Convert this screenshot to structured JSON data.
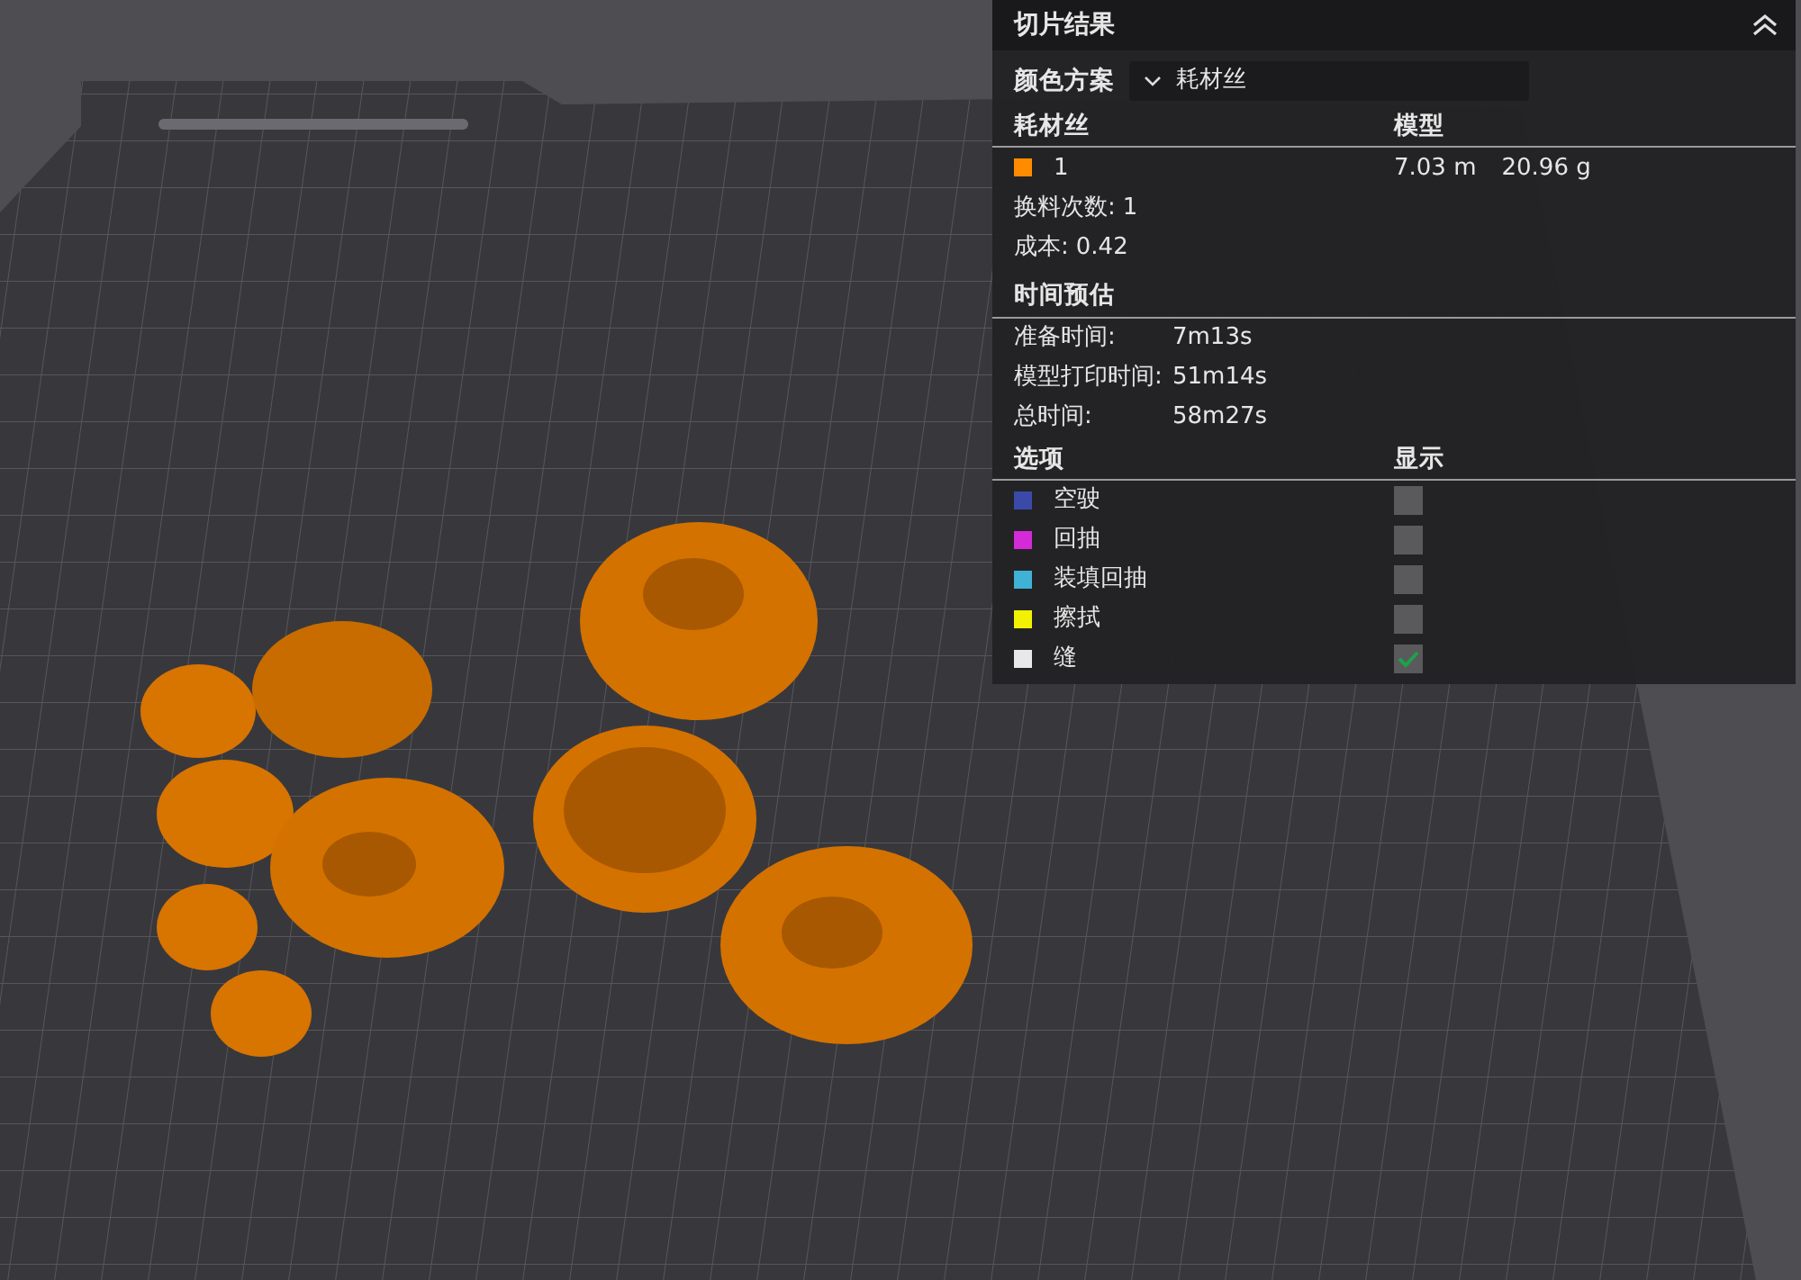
{
  "panel": {
    "title": "切片结果",
    "color_scheme": {
      "label": "颜色方案",
      "value": "耗材丝"
    },
    "filament_header": [
      "耗材丝",
      "模型"
    ],
    "filaments": [
      {
        "id": "1",
        "color": "#ff8c00",
        "length": "7.03 m",
        "weight": "20.96 g"
      }
    ],
    "stats": [
      {
        "label": "换料次数:",
        "value": "1"
      },
      {
        "label": "成本:",
        "value": "0.42"
      }
    ],
    "time_title": "时间预估",
    "times": [
      {
        "label": "准备时间:",
        "value": "7m13s"
      },
      {
        "label": "模型打印时间:",
        "value": "51m14s"
      },
      {
        "label": "总时间:",
        "value": "58m27s"
      }
    ],
    "options_header": [
      "选项",
      "显示"
    ],
    "options": [
      {
        "label": "空驶",
        "color": "#3b4aa8",
        "checked": false
      },
      {
        "label": "回抽",
        "color": "#d42ad8",
        "checked": false
      },
      {
        "label": "装填回抽",
        "color": "#3fb2d6",
        "checked": false
      },
      {
        "label": "擦拭",
        "color": "#f2f200",
        "checked": false
      },
      {
        "label": "缝",
        "color": "#e8e8e8",
        "checked": true
      }
    ]
  }
}
